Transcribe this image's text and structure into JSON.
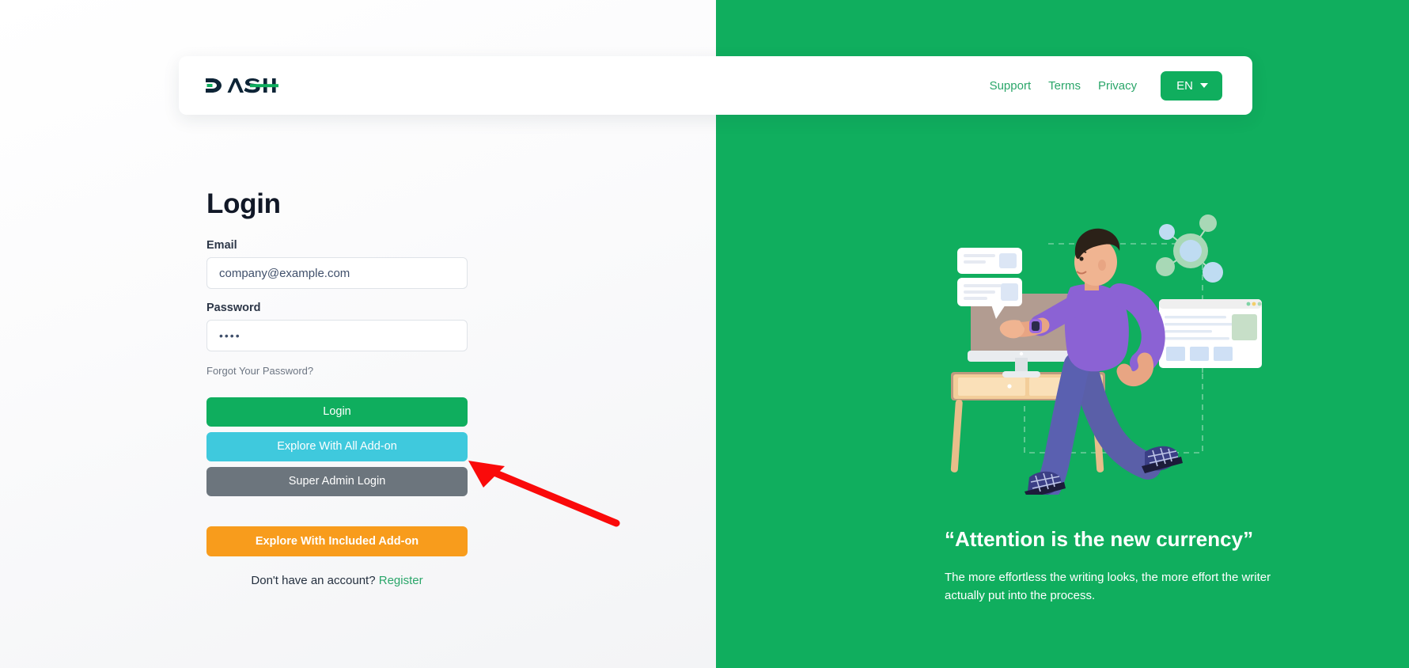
{
  "header": {
    "logo_text": "DASH",
    "logo_name": "dash-logo",
    "nav": [
      {
        "label": "Support",
        "name": "support"
      },
      {
        "label": "Terms",
        "name": "terms"
      },
      {
        "label": "Privacy",
        "name": "privacy"
      }
    ],
    "language": {
      "label": "EN",
      "icon": "chevron-down-icon"
    }
  },
  "login": {
    "title": "Login",
    "email": {
      "label": "Email",
      "value": "company@example.com",
      "placeholder": "company@example.com"
    },
    "password": {
      "label": "Password",
      "value": "••••",
      "placeholder": ""
    },
    "forgot_label": "Forgot Your Password?",
    "buttons": {
      "login": "Login",
      "explore_all": "Explore With All Add-on",
      "super_admin": "Super Admin Login",
      "explore_included": "Explore With Included Add-on"
    },
    "register_prompt": "Don't have an account?",
    "register_label": "Register"
  },
  "promo": {
    "quote": "“Attention is the new currency”",
    "body": "The more effortless the writing looks, the more effort the writer actually put into the process.",
    "illustration_name": "running-man-desk-illustration"
  },
  "annotation": {
    "arrow_color": "#FA0A0A",
    "arrow_target": "explore-with-all-addon-button"
  },
  "colors": {
    "brand_green": "#10AE5E",
    "cyan": "#3FC9DD",
    "gray": "#6C757D",
    "orange": "#F89C1C",
    "logo_dark": "#0D2436"
  }
}
